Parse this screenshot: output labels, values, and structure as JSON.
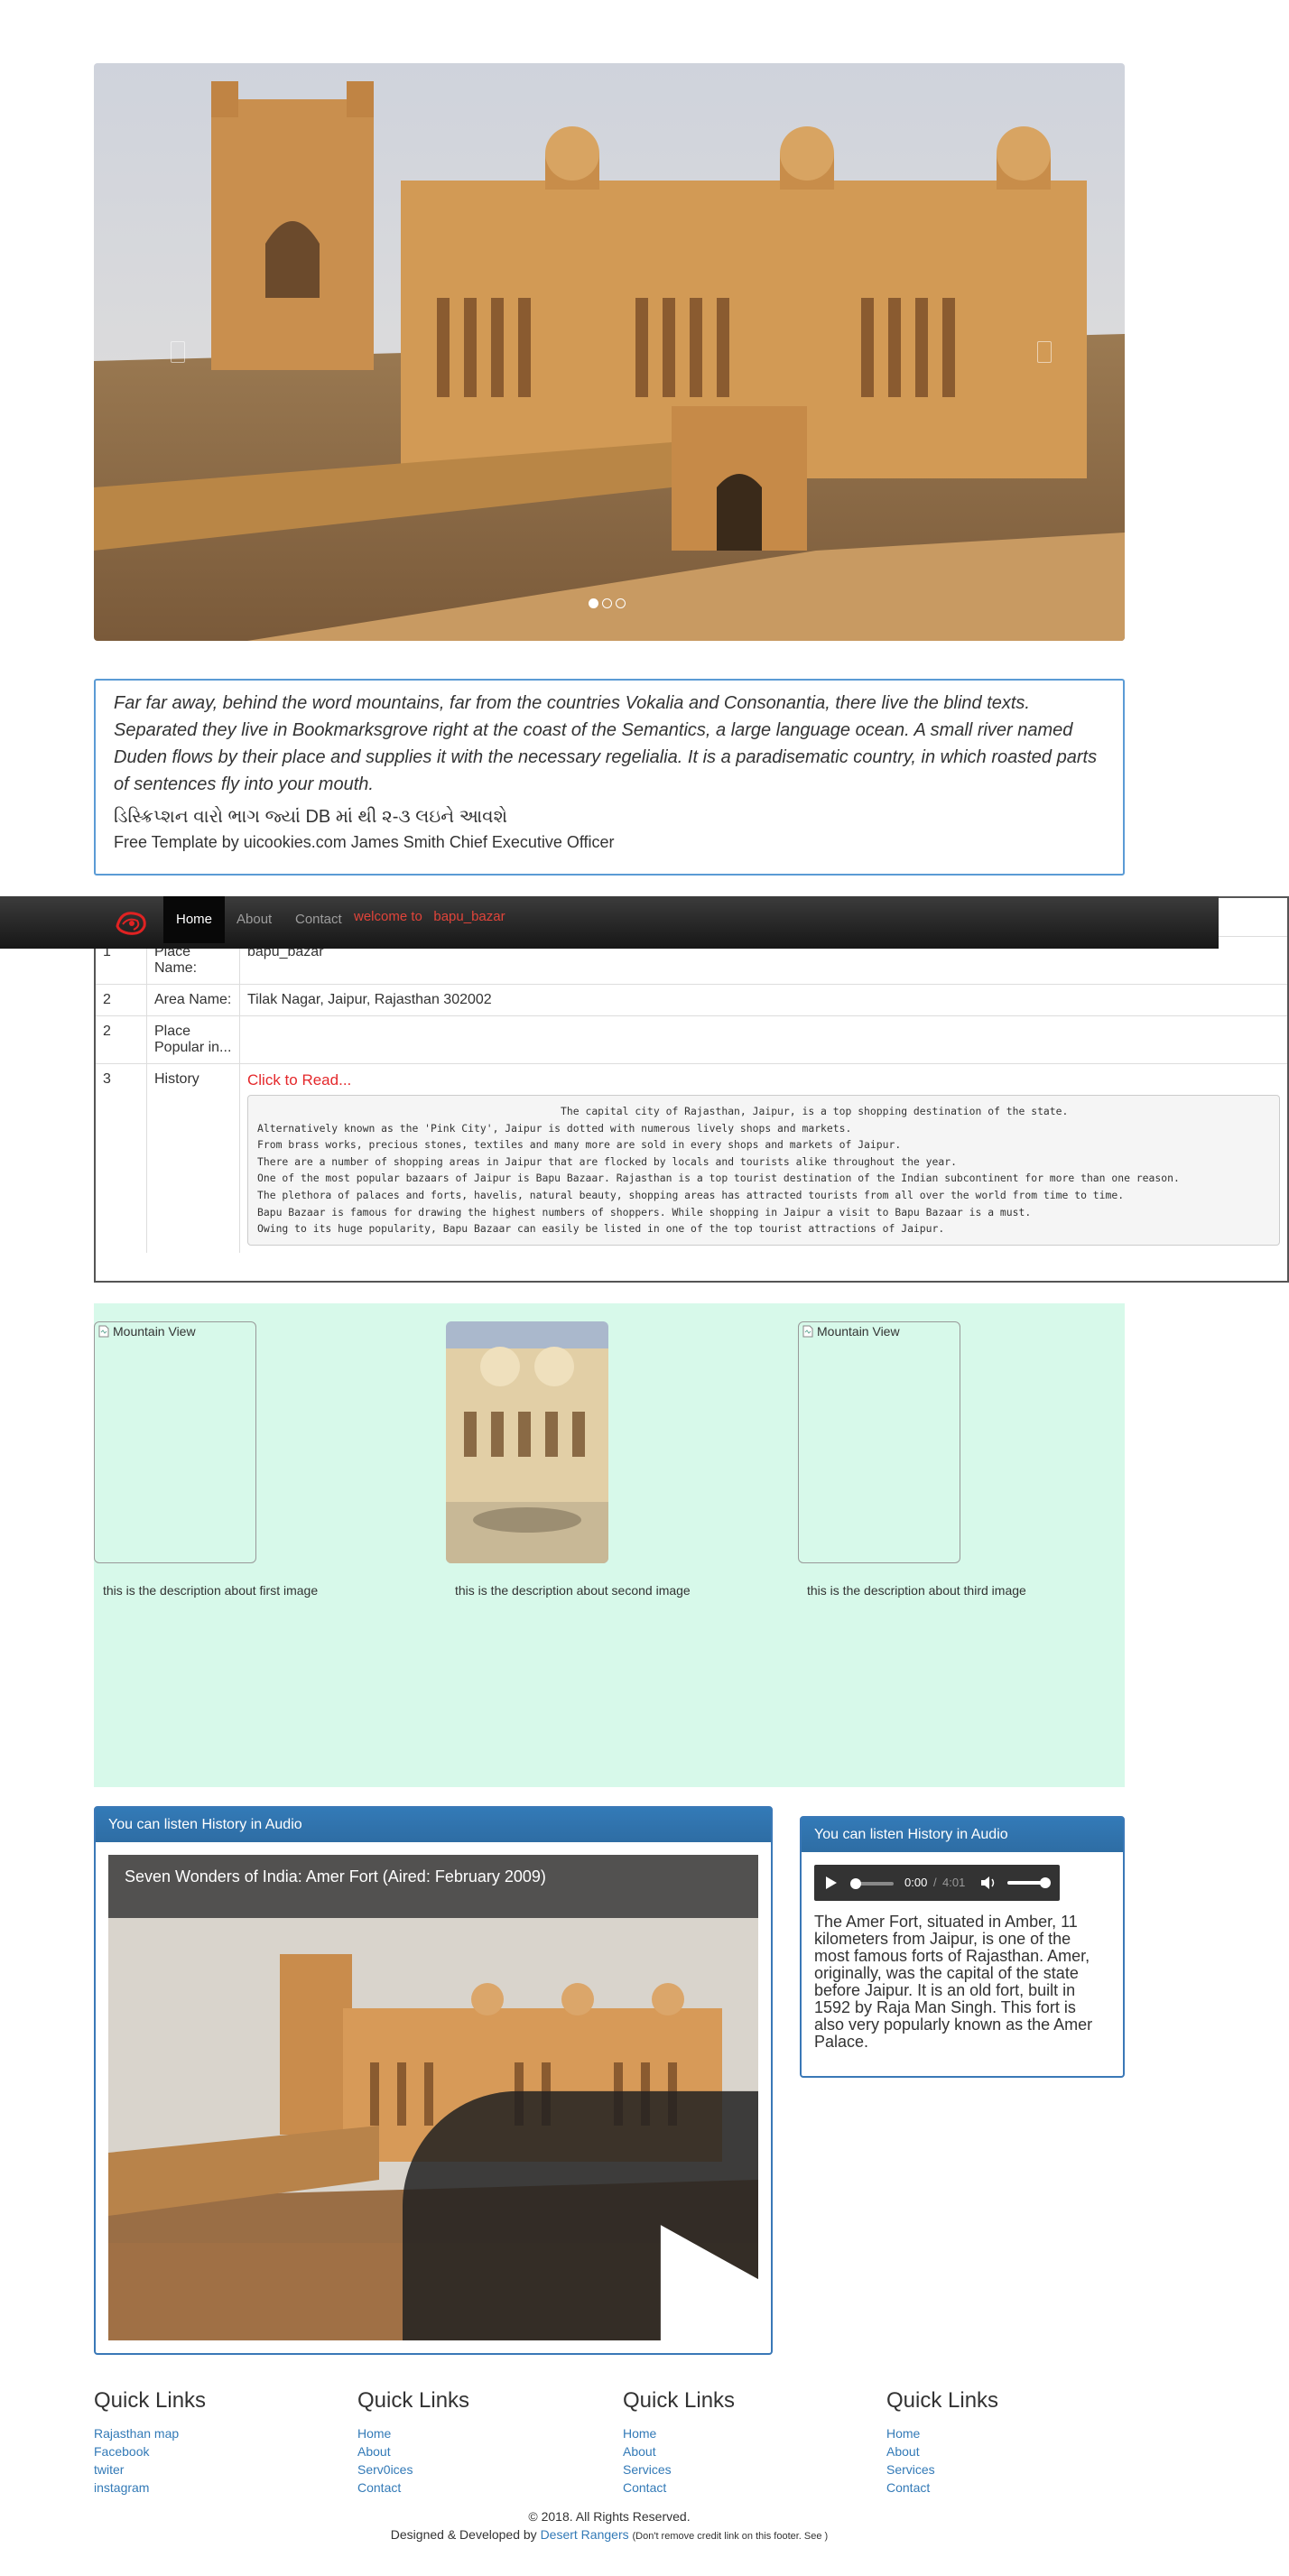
{
  "carousel": {
    "image_alt": "Amer Fort",
    "dots": [
      true,
      false,
      false
    ]
  },
  "quote": {
    "text": "Far far away, behind the word mountains, far from the countries Vokalia and Consonantia, there live the blind texts. Separated they live in Bookmarksgrove right at the coast of the Semantics, a large language ocean. A small river named Duden flows by their place and supplies it with the necessary regelialia. It is a paradisematic country, in which roasted parts of sentences fly into your mouth.",
    "gujarati": "ડિસ્ક્રિપ્શન વારો ભાગ જ્યાં DB માં થી ૨-૩ લઇને આવશે",
    "footer": "Free Template by uicookies.com James Smith Chief Executive Officer"
  },
  "navbar": {
    "items": [
      {
        "label": "Home",
        "active": true
      },
      {
        "label": "About",
        "active": false
      },
      {
        "label": "Contact",
        "active": false
      }
    ],
    "welcome": "welcome to   bapu_bazar"
  },
  "info_table": {
    "rows": [
      {
        "no": "1",
        "label": "Place Name:",
        "value": "bapu_bazar"
      },
      {
        "no": "2",
        "label": "Area Name:",
        "value": "Tilak Nagar, Jaipur, Rajasthan 302002"
      },
      {
        "no": "2",
        "label": "Place Popular in...",
        "value": ""
      },
      {
        "no": "3",
        "label": "History",
        "value": ""
      }
    ],
    "read_link": "Click to Read...",
    "history": "                                                 The capital city of Rajasthan, Jaipur, is a top shopping destination of the state.\nAlternatively known as the 'Pink City', Jaipur is dotted with numerous lively shops and markets.\nFrom brass works, precious stones, textiles and many more are sold in every shops and markets of Jaipur.\nThere are a number of shopping areas in Jaipur that are flocked by locals and tourists alike throughout the year.\nOne of the most popular bazaars of Jaipur is Bapu Bazaar. Rajasthan is a top tourist destination of the Indian subcontinent for more than one reason.\nThe plethora of palaces and forts, havelis, natural beauty, shopping areas has attracted tourists from all over the world from time to time.\nBapu Bazaar is famous for drawing the highest numbers of shoppers. While shopping in Jaipur a visit to Bapu Bazaar is a must.\nOwing to its huge popularity, Bapu Bazaar can easily be listed in one of the top tourist attractions of Jaipur."
  },
  "gallery": {
    "items": [
      {
        "alt": "Mountain View",
        "loaded": false,
        "desc": "this is the description about first image"
      },
      {
        "alt": "",
        "loaded": true,
        "desc": "this is the description about second image"
      },
      {
        "alt": "Mountain View",
        "loaded": false,
        "desc": "this is the description about third image"
      }
    ]
  },
  "video_panel": {
    "heading": "You can listen History in Audio",
    "video_title": "Seven Wonders of India: Amer Fort (Aired: February 2009)"
  },
  "audio_panel": {
    "heading": "You can listen History in Audio",
    "time_current": "0:00",
    "time_separator": "/",
    "time_total": "4:01",
    "text": "The Amer Fort, situated in Amber, 11 kilometers from Jaipur, is one of the most famous forts of Rajasthan. Amer, originally, was the capital of the state before Jaipur. It is an old fort, built in 1592 by Raja Man Singh. This fort is also very popularly known as the Amer Palace."
  },
  "footer": {
    "columns": [
      {
        "heading": "Quick Links",
        "links": [
          "Rajasthan map",
          "Facebook",
          "twiter",
          "instagram"
        ]
      },
      {
        "heading": "Quick Links",
        "links": [
          "Home",
          "About",
          "Serv0ices",
          "Contact"
        ]
      },
      {
        "heading": "Quick Links",
        "links": [
          "Home",
          "About",
          "Services",
          "Contact"
        ]
      },
      {
        "heading": "Quick Links",
        "links": [
          "Home",
          "About",
          "Services",
          "Contact"
        ]
      }
    ],
    "copyright": "© 2018. All Rights Reserved.",
    "credit_prefix": "Designed & Developed by",
    "credit_link": "Desert Rangers",
    "credit_note": "(Don't remove credit link on this footer. See )"
  },
  "colors": {
    "link": "#337ab7",
    "panel_border": "#3a78b7",
    "gallery_bg": "#d7f9ea",
    "navbar_bg": "#222222",
    "accent_red": "#e4282b"
  }
}
